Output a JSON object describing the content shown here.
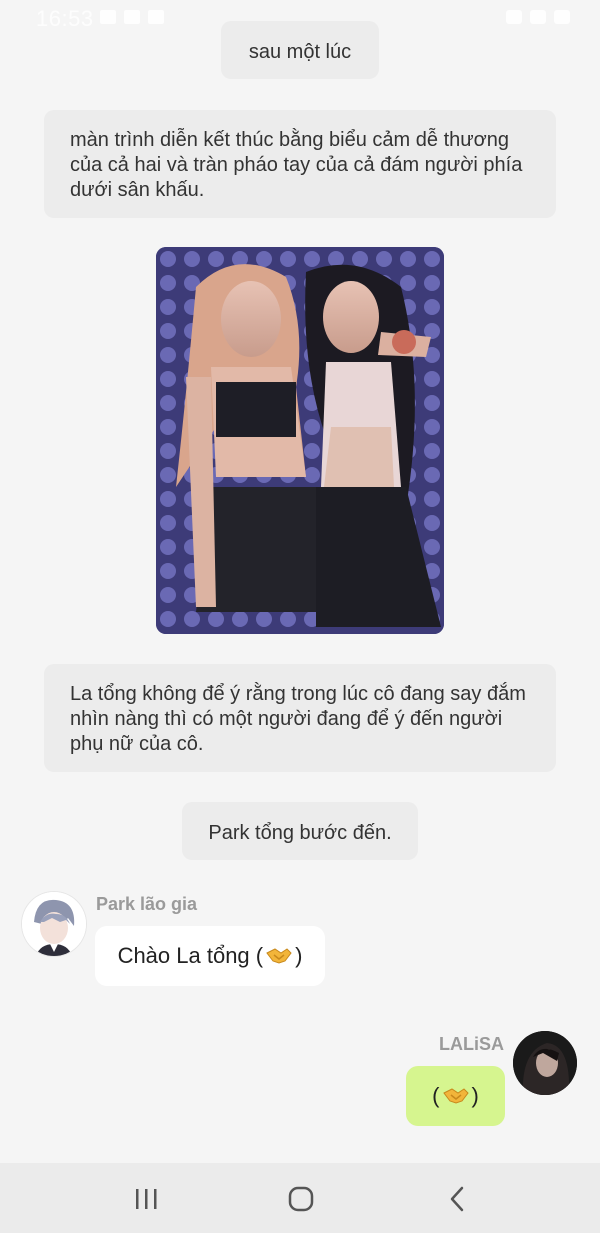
{
  "status_bar": {
    "time": "16:53"
  },
  "narrations": [
    {
      "text": "sau một lúc"
    },
    {
      "text": "màn trình diễn kết thúc bằng biểu cảm dễ thương của cả hai và tràn pháo tay của cả đám người phía dưới sân khấu."
    },
    {
      "text": "La tổng không để ý rằng trong lúc cô đang say đắm nhìn nàng thì có một người đang để ý đến người phụ nữ của cô."
    },
    {
      "text": "Park tổng bước đến."
    }
  ],
  "messages": [
    {
      "sender": "Park lão gia",
      "text_before": "Chào La tổng (",
      "text_after": ")",
      "icon": "handshake-icon",
      "side": "left"
    },
    {
      "sender": "LALiSA",
      "text_before": "(",
      "text_after": ")",
      "icon": "handshake-icon",
      "side": "right"
    }
  ],
  "colors": {
    "background": "#f5f5f5",
    "narration_bg": "#ececec",
    "left_bubble": "#ffffff",
    "right_bubble": "#d6f58f",
    "sender_name": "#9a9a9a",
    "nav_bar": "#ebebeb"
  },
  "nav": {
    "recent_icon": "recent-apps-icon",
    "home_icon": "home-icon",
    "back_icon": "back-icon"
  }
}
